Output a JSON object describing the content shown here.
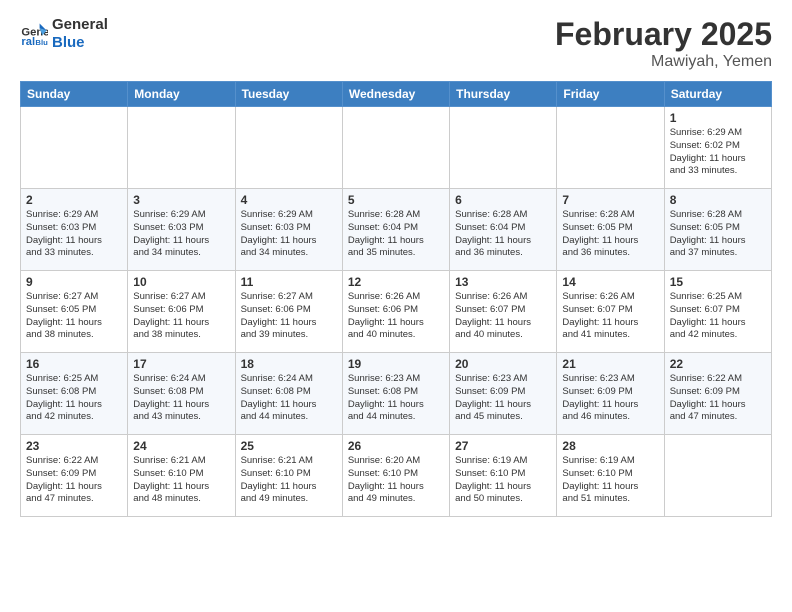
{
  "logo": {
    "line1": "General",
    "line2": "Blue"
  },
  "title": "February 2025",
  "location": "Mawiyah, Yemen",
  "days_of_week": [
    "Sunday",
    "Monday",
    "Tuesday",
    "Wednesday",
    "Thursday",
    "Friday",
    "Saturday"
  ],
  "weeks": [
    [
      {
        "day": "",
        "info": ""
      },
      {
        "day": "",
        "info": ""
      },
      {
        "day": "",
        "info": ""
      },
      {
        "day": "",
        "info": ""
      },
      {
        "day": "",
        "info": ""
      },
      {
        "day": "",
        "info": ""
      },
      {
        "day": "1",
        "info": "Sunrise: 6:29 AM\nSunset: 6:02 PM\nDaylight: 11 hours\nand 33 minutes."
      }
    ],
    [
      {
        "day": "2",
        "info": "Sunrise: 6:29 AM\nSunset: 6:03 PM\nDaylight: 11 hours\nand 33 minutes."
      },
      {
        "day": "3",
        "info": "Sunrise: 6:29 AM\nSunset: 6:03 PM\nDaylight: 11 hours\nand 34 minutes."
      },
      {
        "day": "4",
        "info": "Sunrise: 6:29 AM\nSunset: 6:03 PM\nDaylight: 11 hours\nand 34 minutes."
      },
      {
        "day": "5",
        "info": "Sunrise: 6:28 AM\nSunset: 6:04 PM\nDaylight: 11 hours\nand 35 minutes."
      },
      {
        "day": "6",
        "info": "Sunrise: 6:28 AM\nSunset: 6:04 PM\nDaylight: 11 hours\nand 36 minutes."
      },
      {
        "day": "7",
        "info": "Sunrise: 6:28 AM\nSunset: 6:05 PM\nDaylight: 11 hours\nand 36 minutes."
      },
      {
        "day": "8",
        "info": "Sunrise: 6:28 AM\nSunset: 6:05 PM\nDaylight: 11 hours\nand 37 minutes."
      }
    ],
    [
      {
        "day": "9",
        "info": "Sunrise: 6:27 AM\nSunset: 6:05 PM\nDaylight: 11 hours\nand 38 minutes."
      },
      {
        "day": "10",
        "info": "Sunrise: 6:27 AM\nSunset: 6:06 PM\nDaylight: 11 hours\nand 38 minutes."
      },
      {
        "day": "11",
        "info": "Sunrise: 6:27 AM\nSunset: 6:06 PM\nDaylight: 11 hours\nand 39 minutes."
      },
      {
        "day": "12",
        "info": "Sunrise: 6:26 AM\nSunset: 6:06 PM\nDaylight: 11 hours\nand 40 minutes."
      },
      {
        "day": "13",
        "info": "Sunrise: 6:26 AM\nSunset: 6:07 PM\nDaylight: 11 hours\nand 40 minutes."
      },
      {
        "day": "14",
        "info": "Sunrise: 6:26 AM\nSunset: 6:07 PM\nDaylight: 11 hours\nand 41 minutes."
      },
      {
        "day": "15",
        "info": "Sunrise: 6:25 AM\nSunset: 6:07 PM\nDaylight: 11 hours\nand 42 minutes."
      }
    ],
    [
      {
        "day": "16",
        "info": "Sunrise: 6:25 AM\nSunset: 6:08 PM\nDaylight: 11 hours\nand 42 minutes."
      },
      {
        "day": "17",
        "info": "Sunrise: 6:24 AM\nSunset: 6:08 PM\nDaylight: 11 hours\nand 43 minutes."
      },
      {
        "day": "18",
        "info": "Sunrise: 6:24 AM\nSunset: 6:08 PM\nDaylight: 11 hours\nand 44 minutes."
      },
      {
        "day": "19",
        "info": "Sunrise: 6:23 AM\nSunset: 6:08 PM\nDaylight: 11 hours\nand 44 minutes."
      },
      {
        "day": "20",
        "info": "Sunrise: 6:23 AM\nSunset: 6:09 PM\nDaylight: 11 hours\nand 45 minutes."
      },
      {
        "day": "21",
        "info": "Sunrise: 6:23 AM\nSunset: 6:09 PM\nDaylight: 11 hours\nand 46 minutes."
      },
      {
        "day": "22",
        "info": "Sunrise: 6:22 AM\nSunset: 6:09 PM\nDaylight: 11 hours\nand 47 minutes."
      }
    ],
    [
      {
        "day": "23",
        "info": "Sunrise: 6:22 AM\nSunset: 6:09 PM\nDaylight: 11 hours\nand 47 minutes."
      },
      {
        "day": "24",
        "info": "Sunrise: 6:21 AM\nSunset: 6:10 PM\nDaylight: 11 hours\nand 48 minutes."
      },
      {
        "day": "25",
        "info": "Sunrise: 6:21 AM\nSunset: 6:10 PM\nDaylight: 11 hours\nand 49 minutes."
      },
      {
        "day": "26",
        "info": "Sunrise: 6:20 AM\nSunset: 6:10 PM\nDaylight: 11 hours\nand 49 minutes."
      },
      {
        "day": "27",
        "info": "Sunrise: 6:19 AM\nSunset: 6:10 PM\nDaylight: 11 hours\nand 50 minutes."
      },
      {
        "day": "28",
        "info": "Sunrise: 6:19 AM\nSunset: 6:10 PM\nDaylight: 11 hours\nand 51 minutes."
      },
      {
        "day": "",
        "info": ""
      }
    ]
  ]
}
